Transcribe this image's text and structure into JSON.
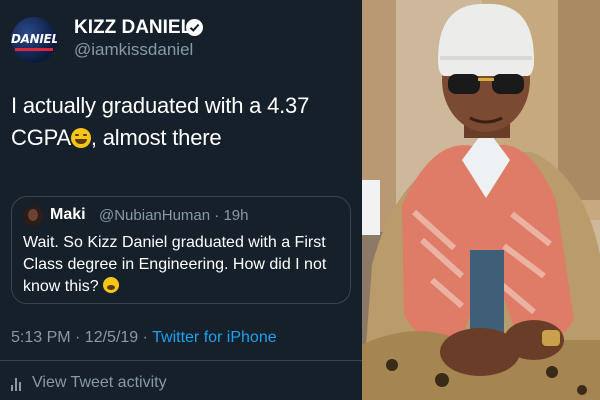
{
  "tweet": {
    "avatar_text": "DANIEL",
    "display_name": "KIZZ DANIEL",
    "verified_icon": "verified-badge-icon",
    "handle": "@iamkissdaniel",
    "text_before_emoji": "I actually graduated with a 4.37 CGPA",
    "emoji": "grinning-face-emoji",
    "text_after_emoji": ", almost there",
    "timestamp": "5:13 PM · 12/5/19 · ",
    "source": "Twitter for iPhone",
    "activity_label": "View Tweet activity",
    "activity_icon": "bar-chart-icon"
  },
  "quoted_tweet": {
    "name": "Maki",
    "handle_time": "@NubianHuman · 19h",
    "text": "Wait. So Kizz Daniel graduated with a First Class degree in Engineering. How did I not know this?",
    "emoji": "exploding-head-emoji"
  },
  "photo": {
    "description": "man-in-beanie-and-scarf-photo"
  },
  "colors": {
    "background": "#15202b",
    "text": "#ffffff",
    "secondary_text": "#8899a6",
    "link": "#1da1f2",
    "border": "#38444d"
  }
}
